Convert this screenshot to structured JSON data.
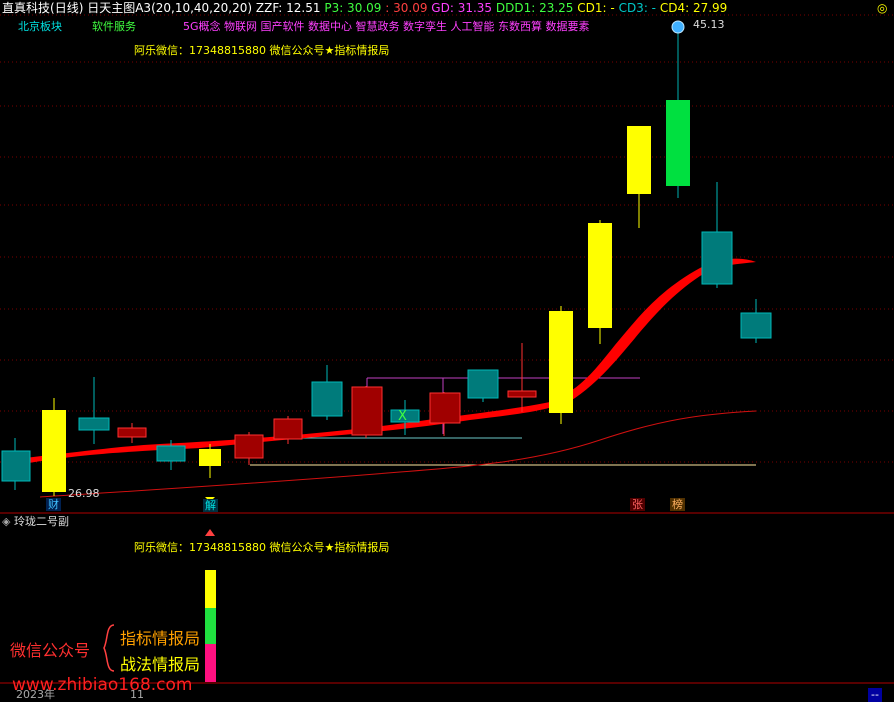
{
  "header": {
    "stock": "直真科技",
    "period": "(日线)",
    "indicator": "日天主图A3(20,10,40,20,20)",
    "zzf": "ZZF: 12.51",
    "p3": "P3: 30.09",
    "dash": ": 30.09",
    "gd": "GD: 31.35",
    "ddd1": "DDD1: 23.25",
    "cd1": "CD1: -",
    "cd3": "CD3: -",
    "cd4": "CD4: 27.99",
    "corner": "◎"
  },
  "tags": {
    "sector1": "北京板块",
    "sector2": "软件服务",
    "concepts": "5G概念 物联网 国产软件 数据中心 智慧政务 数字孪生 人工智能 东数西算 数据要素"
  },
  "contact": "阿乐微信：17348815880  微信公众号★指标情报局",
  "price_labels": {
    "high": "45.13",
    "low": "26.98"
  },
  "badges": {
    "cai": "财",
    "jie": "解",
    "zhang": "张",
    "bang": "榜"
  },
  "sub_panel": {
    "title": "玲珑二号副",
    "contact": "阿乐微信：17348815880  微信公众号★指标情报局"
  },
  "watermark": {
    "left": "微信公众号",
    "right_top": "指标情报局",
    "right_bottom": "战法情报局",
    "url": "www.zhibiao168.com"
  },
  "footer": {
    "year": "2023年",
    "mark": "11",
    "corner": "--"
  },
  "colors": {
    "up": "#ff3232",
    "down": "#00a8a8",
    "yellow": "#ffff00",
    "band": "#ff0000",
    "green": "#00e040",
    "magenta": "#ff00ff"
  }
}
